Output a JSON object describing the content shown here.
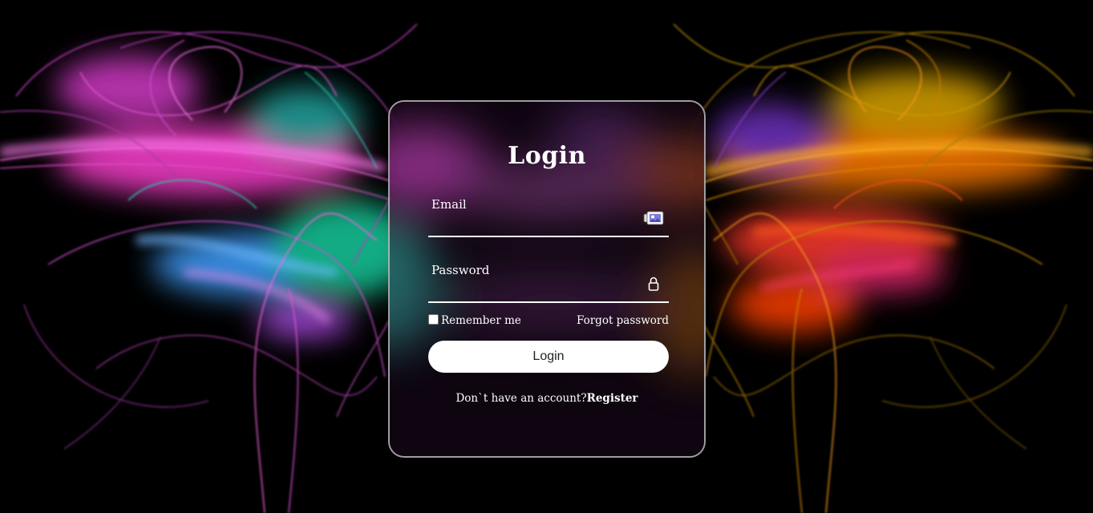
{
  "form": {
    "title": "Login",
    "email": {
      "label": "Email",
      "value": "",
      "icon": "id-card-icon"
    },
    "password": {
      "label": "Password",
      "value": "",
      "icon": "lock-icon"
    },
    "remember_label": "Remember me",
    "remember_checked": false,
    "forgot_label": "Forgot password",
    "submit_label": "Login",
    "register_prompt": "Don`t have an account?",
    "register_link": "Register"
  },
  "colors": {
    "background": "#000000",
    "text": "#ffffff",
    "button_bg": "#ffffff",
    "button_text": "#222222",
    "card_border": "#d2d2d2",
    "left_glow": "#ff4fd8",
    "left_accent": "#1fd6a8",
    "right_glow": "#ff6a00",
    "right_accent": "#c8b800"
  }
}
